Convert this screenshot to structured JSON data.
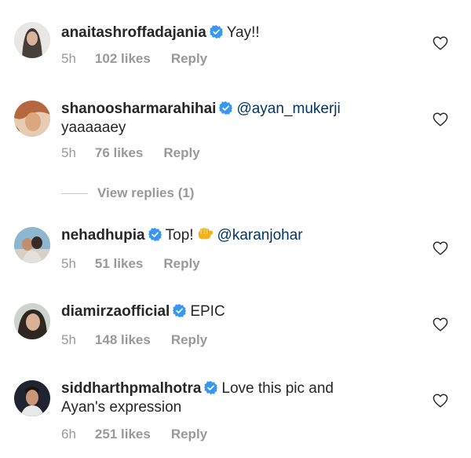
{
  "comments": [
    {
      "username": "anaitashroffadajania",
      "text": "Yay!!",
      "mention": "",
      "text2": "",
      "time": "5h",
      "likes": "102 likes",
      "reply": "Reply"
    },
    {
      "username": "shanoosharmarahihai",
      "text": "",
      "mention": "@ayan_mukerji",
      "text2": "yaaaaaey",
      "time": "5h",
      "likes": "76 likes",
      "reply": "Reply"
    },
    {
      "username": "nehadhupia",
      "text": "Top!",
      "mention": "@karanjohar",
      "text2": "",
      "time": "5h",
      "likes": "51 likes",
      "reply": "Reply"
    },
    {
      "username": "diamirzaofficial",
      "text": "EPIC",
      "mention": "",
      "text2": "",
      "time": "5h",
      "likes": "148 likes",
      "reply": "Reply"
    },
    {
      "username": "siddharthpmalhotra",
      "text": "Love this pic and",
      "mention": "",
      "text2": "Ayan's expression",
      "time": "6h",
      "likes": "251 likes",
      "reply": "Reply"
    }
  ],
  "view_replies": "View replies (1)",
  "icons": {
    "verified": "verified-badge-icon",
    "heart": "heart-outline-icon",
    "emoji": "fist-emoji-icon"
  },
  "colors": {
    "verified_blue": "#3897f0",
    "meta_gray": "#999999",
    "text": "#262626",
    "mention": "#003569"
  }
}
